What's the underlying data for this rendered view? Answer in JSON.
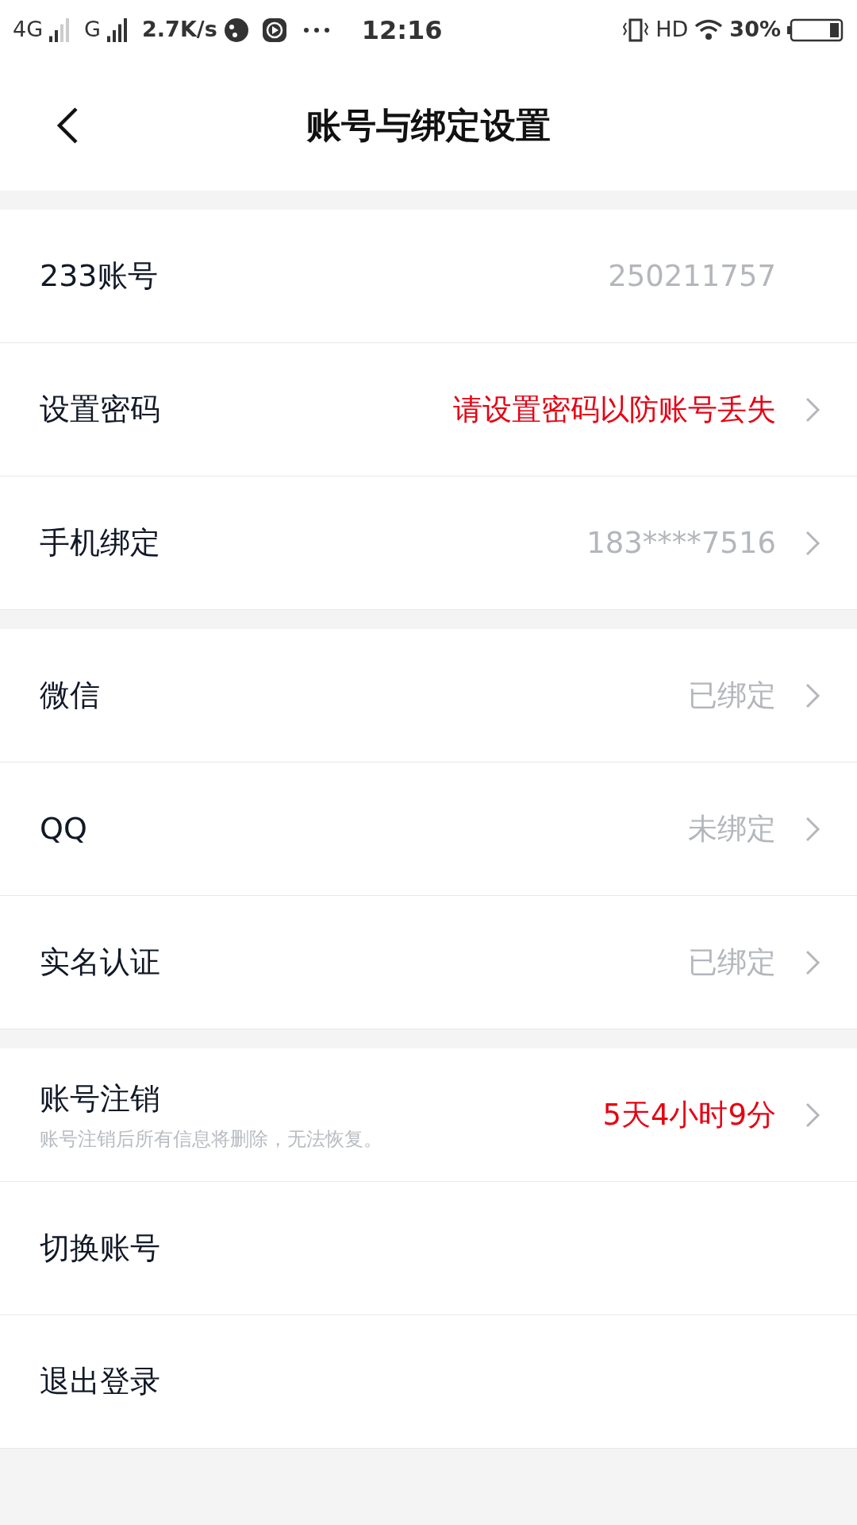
{
  "status_bar": {
    "network_1": "4G",
    "network_2": "G",
    "speed": "2.7K/s",
    "time": "12:16",
    "hd": "HD",
    "battery": "30%"
  },
  "header": {
    "title": "账号与绑定设置"
  },
  "sections": [
    {
      "rows": [
        {
          "label": "233账号",
          "value": "250211757",
          "alert": false,
          "chevron": false
        },
        {
          "label": "设置密码",
          "value": "请设置密码以防账号丢失",
          "alert": true,
          "chevron": true
        },
        {
          "label": "手机绑定",
          "value": "183****7516",
          "alert": false,
          "chevron": true
        }
      ]
    },
    {
      "rows": [
        {
          "label": "微信",
          "value": "已绑定",
          "alert": false,
          "chevron": true
        },
        {
          "label": "QQ",
          "value": "未绑定",
          "alert": false,
          "chevron": true
        },
        {
          "label": "实名认证",
          "value": "已绑定",
          "alert": false,
          "chevron": true
        }
      ]
    },
    {
      "rows": [
        {
          "label": "账号注销",
          "subtitle": "账号注销后所有信息将删除，无法恢复。",
          "value": "5天4小时9分",
          "alert": true,
          "chevron": true
        },
        {
          "label": "切换账号",
          "chevron": false
        },
        {
          "label": "退出登录",
          "chevron": false
        }
      ]
    }
  ]
}
